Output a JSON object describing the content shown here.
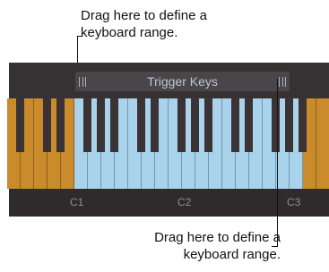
{
  "callouts": {
    "top_line1": "Drag here to define a",
    "top_line2": "keyboard range.",
    "bottom_line1": "Drag here to define a",
    "bottom_line2": "keyboard range."
  },
  "range_bar": {
    "label": "Trigger Keys"
  },
  "keyboard": {
    "octaves": [
      "C1",
      "C2",
      "C3"
    ],
    "white_keys_total": 24,
    "active_range_start": 5,
    "active_range_end": 21
  },
  "colors": {
    "inactive_key": "#c98b2b",
    "active_key": "#a9d3ea",
    "panel": "#363132"
  }
}
